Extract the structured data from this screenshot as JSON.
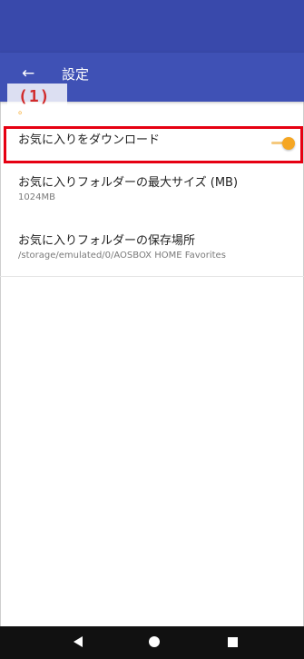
{
  "app_bar": {
    "back_glyph": "←",
    "title": "設定"
  },
  "annotation": {
    "label": "(1)",
    "color": "#e60012"
  },
  "section_header": {
    "label": "。"
  },
  "settings": [
    {
      "title": "お気に入りをダウンロード",
      "toggle_on": true
    },
    {
      "title": "お気に入りフォルダーの最大サイズ (MB)",
      "value": "1024MB"
    },
    {
      "title": "お気に入りフォルダーの保存場所",
      "value": "/storage/emulated/0/AOSBOX HOME Favorites"
    }
  ],
  "colors": {
    "status_bar": "#3949ab",
    "app_bar": "#3f51b5",
    "accent": "#f5a623",
    "nav_bar": "#111111"
  },
  "nav_icons": [
    "back-icon",
    "home-icon",
    "recent-apps-icon"
  ]
}
